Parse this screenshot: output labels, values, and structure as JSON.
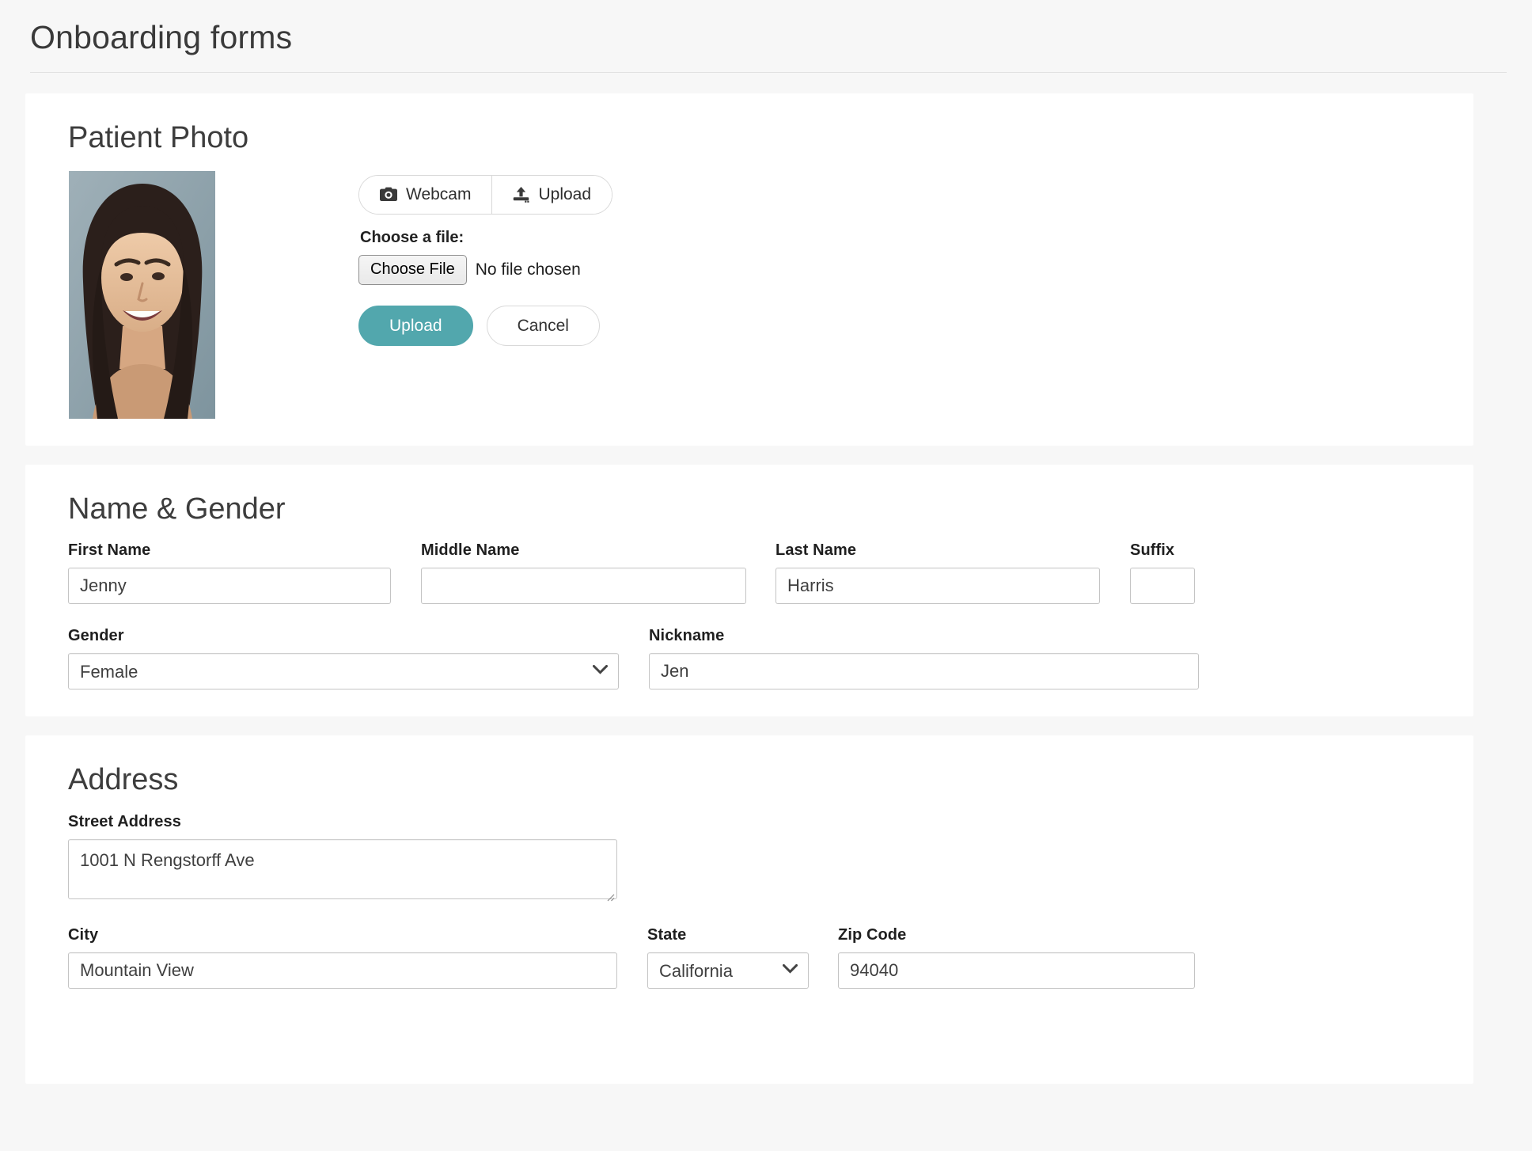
{
  "page": {
    "title": "Onboarding forms",
    "accent_color": "#52a7ad",
    "background_color": "#f7f7f7",
    "card_color": "#ffffff"
  },
  "patient_photo": {
    "title": "Patient Photo",
    "photo_alt": "patient portrait",
    "source_tabs": [
      {
        "label": "Webcam",
        "icon": "camera-icon"
      },
      {
        "label": "Upload",
        "icon": "upload-icon"
      }
    ],
    "choose_file_label": "Choose a file:",
    "file_button_label": "Choose File",
    "file_status": "No file chosen",
    "upload_button": "Upload",
    "cancel_button": "Cancel"
  },
  "name_gender": {
    "title": "Name & Gender",
    "fields": {
      "first_name": {
        "label": "First Name",
        "value": "Jenny"
      },
      "middle_name": {
        "label": "Middle Name",
        "value": ""
      },
      "last_name": {
        "label": "Last Name",
        "value": "Harris"
      },
      "suffix": {
        "label": "Suffix",
        "value": ""
      },
      "gender": {
        "label": "Gender",
        "value": "Female"
      },
      "nickname": {
        "label": "Nickname",
        "value": "Jen"
      }
    }
  },
  "address": {
    "title": "Address",
    "fields": {
      "street": {
        "label": "Street Address",
        "value": "1001 N Rengstorff Ave"
      },
      "city": {
        "label": "City",
        "value": "Mountain View"
      },
      "state": {
        "label": "State",
        "value": "California"
      },
      "zip": {
        "label": "Zip Code",
        "value": "94040"
      }
    }
  }
}
